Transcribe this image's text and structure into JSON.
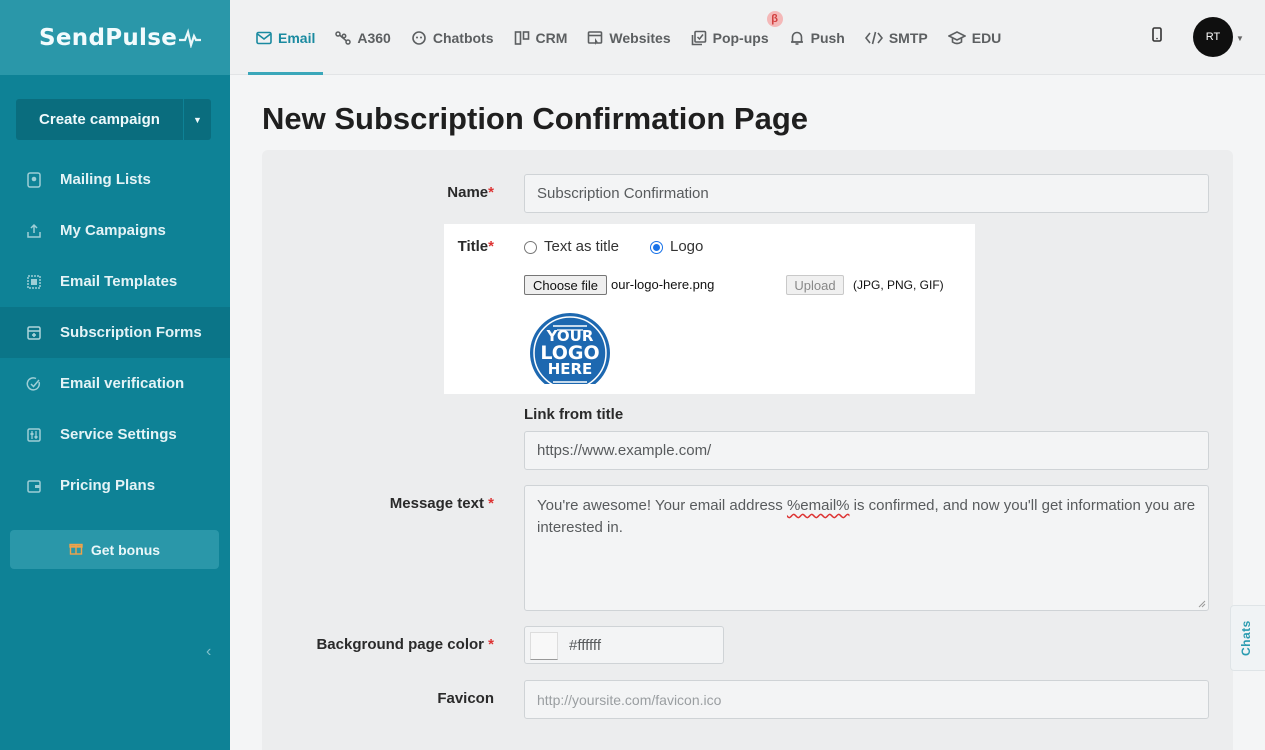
{
  "brand": {
    "logo_text": "SendPulse"
  },
  "sidebar": {
    "create_campaign": "Create campaign",
    "items": [
      {
        "label": "Mailing Lists",
        "icon": "address-book-icon"
      },
      {
        "label": "My Campaigns",
        "icon": "campaign-send-icon"
      },
      {
        "label": "Email Templates",
        "icon": "template-icon"
      },
      {
        "label": "Subscription Forms",
        "icon": "form-icon",
        "active": true
      },
      {
        "label": "Email verification",
        "icon": "check-circle-icon"
      },
      {
        "label": "Service Settings",
        "icon": "sliders-icon"
      },
      {
        "label": "Pricing Plans",
        "icon": "wallet-icon"
      }
    ],
    "bonus": "Get bonus"
  },
  "topnav": {
    "items": [
      {
        "label": "Email",
        "icon": "envelope-icon",
        "active": true
      },
      {
        "label": "A360",
        "icon": "nodes-icon"
      },
      {
        "label": "Chatbots",
        "icon": "chat-bubble-icon"
      },
      {
        "label": "CRM",
        "icon": "crm-board-icon"
      },
      {
        "label": "Websites",
        "icon": "website-icon"
      },
      {
        "label": "Pop-ups",
        "icon": "popup-icon",
        "badge": "β"
      },
      {
        "label": "Push",
        "icon": "bell-icon"
      },
      {
        "label": "SMTP",
        "icon": "code-icon"
      },
      {
        "label": "EDU",
        "icon": "graduation-cap-icon"
      }
    ],
    "avatar_text": "RT"
  },
  "page": {
    "title": "New Subscription Confirmation Page"
  },
  "form": {
    "name_label": "Name",
    "name_value": "Subscription Confirmation",
    "title_label": "Title",
    "title_option_text": "Text as title",
    "title_option_logo": "Logo",
    "choose_file": "Choose file",
    "file_name": "our-logo-here.png",
    "upload": "Upload",
    "formats": "(JPG, PNG, GIF)",
    "logo_line1": "YOUR",
    "logo_line2": "LOGO",
    "logo_line3": "HERE",
    "link_label": "Link from title",
    "link_value": "https://www.example.com/",
    "message_label": "Message text",
    "message_before": "You're awesome! Your email address ",
    "message_token": "%email%",
    "message_after": " is confirmed, and now you'll get information you are interested in.",
    "bg_label": "Background page color",
    "bg_value": "#ffffff",
    "favicon_label": "Favicon",
    "favicon_placeholder": "http://yoursite.com/favicon.ico"
  },
  "chats_tab": "Chats",
  "colors": {
    "sidebar": "#0e8296",
    "accent": "#1a8aa0"
  }
}
